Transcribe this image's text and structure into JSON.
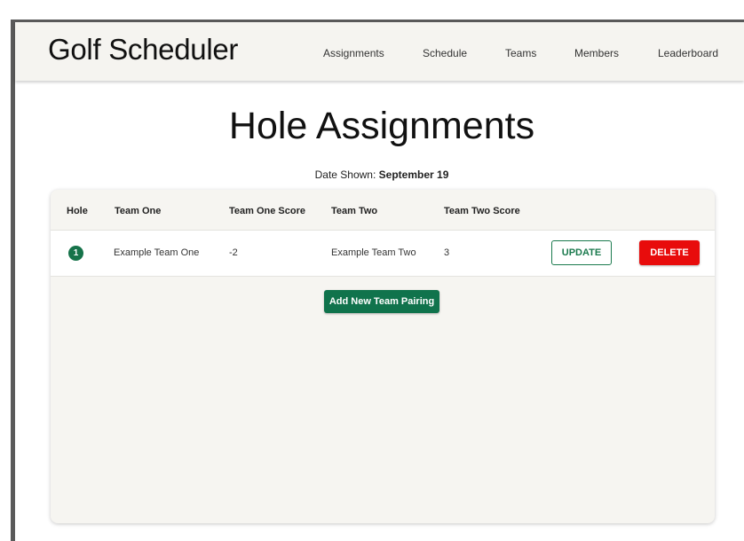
{
  "app": {
    "title": "Golf Scheduler"
  },
  "nav": {
    "items": [
      {
        "label": "Assignments"
      },
      {
        "label": "Schedule"
      },
      {
        "label": "Teams"
      },
      {
        "label": "Members"
      },
      {
        "label": "Leaderboard"
      }
    ]
  },
  "page": {
    "title": "Hole Assignments",
    "date_prefix": "Date Shown:",
    "date_value": "September 19"
  },
  "table": {
    "headers": [
      "Hole",
      "Team One",
      "Team One Score",
      "Team Two",
      "Team Two Score"
    ],
    "rows": [
      {
        "hole": "1",
        "team_one": "Example Team One",
        "team_one_score": "-2",
        "team_two": "Example Team Two",
        "team_two_score": "3",
        "update_label": "UPDATE",
        "delete_label": "DELETE"
      }
    ]
  },
  "actions": {
    "add_label": "Add New Team Pairing"
  },
  "colors": {
    "accent_green": "#10734c",
    "delete_red": "#e80c0c",
    "nav_background": "#f5f4f0"
  }
}
